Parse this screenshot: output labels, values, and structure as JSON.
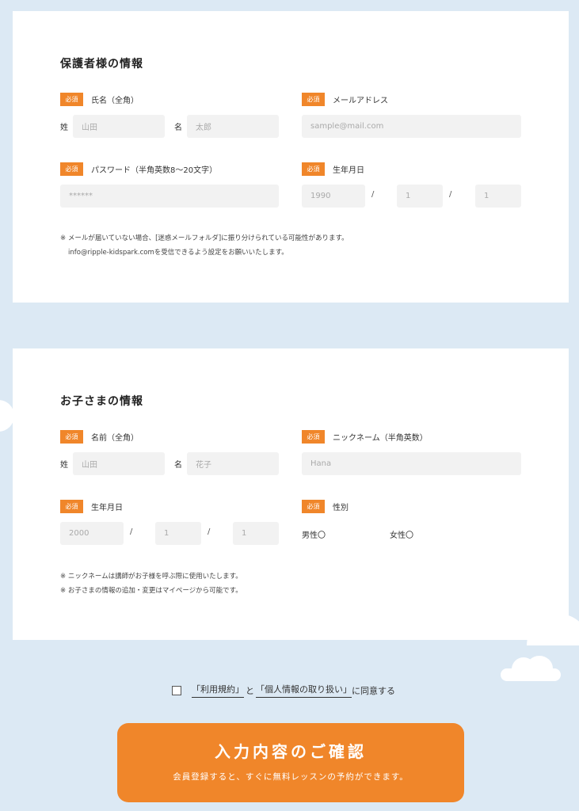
{
  "guardian": {
    "title": "保護者様の情報",
    "name": {
      "badge": "必須",
      "label": "氏名（全角）",
      "last_prefix": "姓",
      "last_placeholder": "山田",
      "first_prefix": "名",
      "first_placeholder": "太郎"
    },
    "email": {
      "badge": "必須",
      "label": "メールアドレス",
      "placeholder": "sample@mail.com"
    },
    "password": {
      "badge": "必須",
      "label": "パスワード（半角英数8〜20文字）",
      "placeholder": "******"
    },
    "birthday": {
      "badge": "必須",
      "label": "生年月日",
      "year": "1990",
      "month": "1",
      "day": "1",
      "sep": "/"
    },
    "notes": [
      "※ メールが届いていない場合、[迷惑メールフォルダ]に振り分けられている可能性があります。",
      "info@ripple-kidspark.comを受信できるよう設定をお願いいたします。"
    ]
  },
  "child": {
    "title": "お子さまの情報",
    "name": {
      "badge": "必須",
      "label": "名前（全角）",
      "last_prefix": "姓",
      "last_placeholder": "山田",
      "first_prefix": "名",
      "first_placeholder": "花子"
    },
    "nickname": {
      "badge": "必須",
      "label": "ニックネーム（半角英数）",
      "placeholder": "Hana"
    },
    "birthday": {
      "badge": "必須",
      "label": "生年月日",
      "year": "2000",
      "month": "1",
      "day": "1",
      "sep": "/"
    },
    "gender": {
      "badge": "必須",
      "label": "性別",
      "male": "男性〇",
      "female": "女性〇"
    },
    "notes": [
      "※ ニックネームは講師がお子様を呼ぶ際に使用いたします。",
      "※ お子さまの情報の追加・変更はマイページから可能です。"
    ]
  },
  "agreement": {
    "terms": "「利用規約」",
    "and": "と",
    "privacy": "「個人情報の取り扱い」",
    "suffix": "に同意する"
  },
  "cta": {
    "main": "入力内容のご確認",
    "sub": "会員登録すると、すぐに無料レッスンの予約ができます。"
  },
  "colors": {
    "accent": "#f0862a",
    "background": "#dce9f4"
  }
}
